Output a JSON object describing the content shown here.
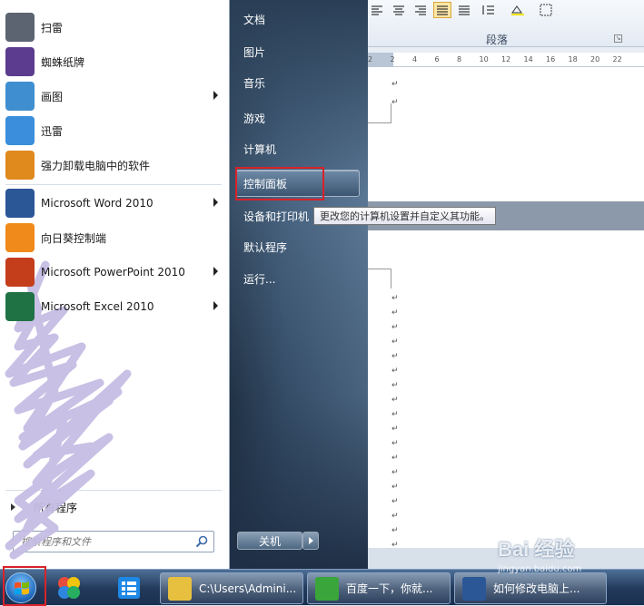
{
  "start_menu": {
    "programs": [
      {
        "label": "扫雷",
        "icon": "minesweeper-icon",
        "color": "#5b6470",
        "arrow": false
      },
      {
        "label": "蜘蛛纸牌",
        "icon": "spider-solitaire-icon",
        "color": "#5c3c8e",
        "arrow": false
      },
      {
        "label": "画图",
        "icon": "paint-icon",
        "color": "#3f8fd0",
        "arrow": true
      },
      {
        "label": "迅雷",
        "icon": "xunlei-icon",
        "color": "#3b8edb",
        "arrow": false
      },
      {
        "label": "强力卸载电脑中的软件",
        "icon": "uninstaller-icon",
        "color": "#e08a1e",
        "arrow": false
      },
      {
        "label": "Microsoft Word 2010",
        "icon": "word-icon",
        "color": "#2b5797",
        "arrow": true
      },
      {
        "label": "向日葵控制端",
        "icon": "sunflower-icon",
        "color": "#f08a1a",
        "arrow": false
      },
      {
        "label": "Microsoft PowerPoint 2010",
        "icon": "powerpoint-icon",
        "color": "#c43e1c",
        "arrow": true
      },
      {
        "label": "Microsoft Excel 2010",
        "icon": "excel-icon",
        "color": "#1f7244",
        "arrow": true
      }
    ],
    "all_programs": "所有程序",
    "search_placeholder": "搜索程序和文件",
    "places": [
      {
        "label": "文档"
      },
      {
        "label": "图片"
      },
      {
        "label": "音乐"
      },
      {
        "label": "游戏"
      },
      {
        "label": "计算机"
      },
      {
        "label": "控制面板"
      },
      {
        "label": "设备和打印机"
      },
      {
        "label": "默认程序"
      },
      {
        "label": "运行..."
      }
    ],
    "shutdown_label": "关机",
    "tooltip": "更改您的计算机设置并自定义其功能。"
  },
  "word": {
    "ribbon_group": "段落",
    "ruler_ticks": [
      "2",
      "2",
      "4",
      "6",
      "8",
      "10",
      "12",
      "14",
      "16",
      "18",
      "20",
      "22"
    ],
    "paragraph_mark": "↵"
  },
  "taskbar": {
    "buttons": [
      {
        "label": "C:\\Users\\Admini...",
        "icon": "folder-icon",
        "color": "#e8c040"
      },
      {
        "label": "百度一下，你就...",
        "icon": "browser-icon",
        "color": "#3aa53a"
      },
      {
        "label": "如何修改电脑上...",
        "icon": "word-doc-icon",
        "color": "#2b5797"
      }
    ]
  },
  "watermark": {
    "brand": "Bai 经验",
    "url": "jingyan.baidu.com"
  },
  "colors": {
    "highlight_red": "#d8232a",
    "taskbar_blue": "#21395a"
  }
}
